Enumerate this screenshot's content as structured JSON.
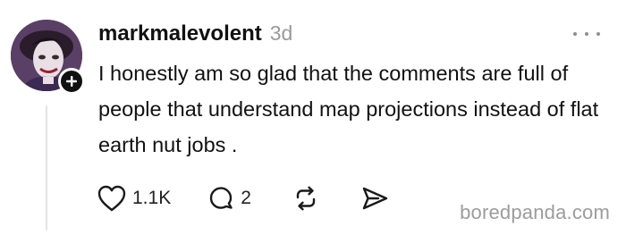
{
  "post": {
    "username": "markmalevolent",
    "timestamp": "3d",
    "text": "I honestly am so glad that the comments are full of people that understand map projections instead of flat earth nut jobs ."
  },
  "actions": {
    "likes_count": "1.1K",
    "replies_count": "2"
  },
  "icons": {
    "more": "more-horizontal-icon",
    "follow": "plus-icon",
    "like": "heart-icon",
    "reply": "comment-bubble-icon",
    "repost": "repost-arrows-icon",
    "share": "send-icon"
  },
  "watermark": "boredpanda.com",
  "colors": {
    "text": "#111111",
    "muted": "#9a9a9a",
    "thread_line": "#e4e4e4"
  }
}
